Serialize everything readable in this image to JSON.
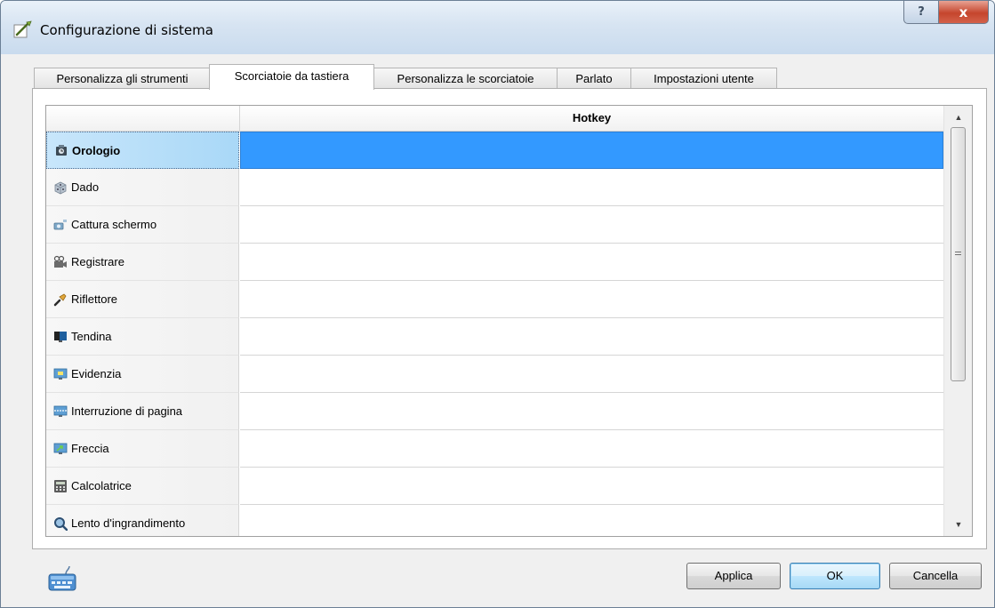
{
  "window": {
    "title": "Configurazione di sistema",
    "help_label": "?",
    "close_label": "x"
  },
  "tabs": [
    {
      "label": "Personalizza gli strumenti",
      "active": false
    },
    {
      "label": "Scorciatoie da tastiera",
      "active": true
    },
    {
      "label": "Personalizza le scorciatoie",
      "active": false
    },
    {
      "label": "Parlato",
      "active": false
    },
    {
      "label": "Impostazioni utente",
      "active": false
    }
  ],
  "table": {
    "column_header": "Hotkey",
    "rows": [
      {
        "label": "Orologio",
        "icon": "clock-icon",
        "hotkey": "",
        "selected": true
      },
      {
        "label": "Dado",
        "icon": "dice-icon",
        "hotkey": "",
        "selected": false
      },
      {
        "label": "Cattura schermo",
        "icon": "screen-capture-icon",
        "hotkey": "",
        "selected": false
      },
      {
        "label": "Registrare",
        "icon": "video-recorder-icon",
        "hotkey": "",
        "selected": false
      },
      {
        "label": "Riflettore",
        "icon": "spotlight-icon",
        "hotkey": "",
        "selected": false
      },
      {
        "label": "Tendina",
        "icon": "screen-shade-icon",
        "hotkey": "",
        "selected": false
      },
      {
        "label": "Evidenzia",
        "icon": "highlight-icon",
        "hotkey": "",
        "selected": false
      },
      {
        "label": "Interruzione di pagina",
        "icon": "page-break-icon",
        "hotkey": "",
        "selected": false
      },
      {
        "label": "Freccia",
        "icon": "arrow-icon",
        "hotkey": "",
        "selected": false
      },
      {
        "label": "Calcolatrice",
        "icon": "calculator-icon",
        "hotkey": "",
        "selected": false
      },
      {
        "label": "Lento d'ingrandimento",
        "icon": "magnifier-icon",
        "hotkey": "",
        "selected": false
      }
    ]
  },
  "footer": {
    "keyboard_icon": "keyboard-icon",
    "apply_label": "Applica",
    "ok_label": "OK",
    "cancel_label": "Cancella"
  },
  "colors": {
    "selection": "#3399ff",
    "title_gradient": "#d7e4f2",
    "close_button": "#c5452d"
  }
}
